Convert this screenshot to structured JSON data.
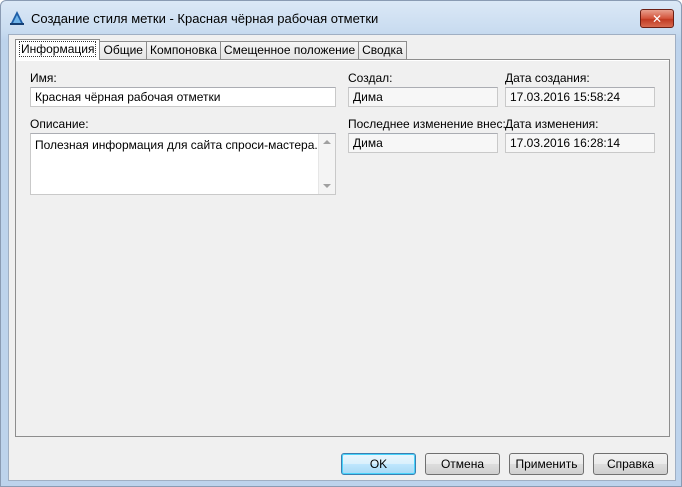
{
  "window": {
    "title": "Создание стиля метки - Красная чёрная рабочая отметки",
    "close_glyph": "✕"
  },
  "tabs": [
    {
      "label": "Информация",
      "active": true
    },
    {
      "label": "Общие",
      "active": false
    },
    {
      "label": "Компоновка",
      "active": false
    },
    {
      "label": "Смещенное положение",
      "active": false
    },
    {
      "label": "Сводка",
      "active": false
    }
  ],
  "info": {
    "name_label": "Имя:",
    "name_value": "Красная чёрная рабочая отметки",
    "description_label": "Описание:",
    "description_value": "Полезная информация для сайта спроси-мастера.рф",
    "created_by_label": "Создал:",
    "created_by_value": "Дима",
    "created_date_label": "Дата создания:",
    "created_date_value": "17.03.2016 15:58:24",
    "modified_by_label": "Последнее изменение внес:",
    "modified_by_value": "Дима",
    "modified_date_label": "Дата изменения:",
    "modified_date_value": "17.03.2016 16:28:14"
  },
  "buttons": {
    "ok": "OK",
    "cancel": "Отмена",
    "apply": "Применить",
    "help": "Справка"
  },
  "colors": {
    "accent": "#3c7fb1",
    "close": "#c13a22"
  }
}
